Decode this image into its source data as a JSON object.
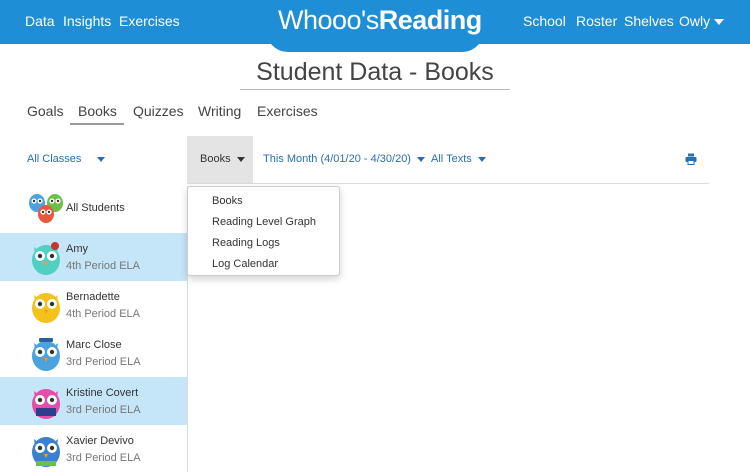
{
  "nav": {
    "left": [
      "Data",
      "Insights",
      "Exercises"
    ],
    "right": [
      "School",
      "Roster",
      "Shelves"
    ],
    "user": "Owly"
  },
  "logo": {
    "part1": "Whooo's",
    "part2": "Reading"
  },
  "page_title": "Student Data - Books",
  "tabs": [
    "Goals",
    "Books",
    "Quizzes",
    "Writing",
    "Exercises"
  ],
  "active_tab": "Books",
  "filters": {
    "classes": "All Classes",
    "view": "Books",
    "period": "This Month (4/01/20 - 4/30/20)",
    "texts": "All Texts"
  },
  "view_menu": [
    "Books",
    "Reading Level Graph",
    "Reading Logs",
    "Log Calendar"
  ],
  "all_students_label": "All Students",
  "students": [
    {
      "name": "Amy",
      "class": "4th Period ELA",
      "selected": true,
      "owl_color": "#4fd0c0"
    },
    {
      "name": "Bernadette",
      "class": "4th Period ELA",
      "selected": false,
      "owl_color": "#f5c21b"
    },
    {
      "name": "Marc Close",
      "class": "3rd Period ELA",
      "selected": false,
      "owl_color": "#4aa3df"
    },
    {
      "name": "Kristine Covert",
      "class": "3rd Period ELA",
      "selected": true,
      "owl_color": "#e64ca8"
    },
    {
      "name": "Xavier Devivo",
      "class": "3rd Period ELA",
      "selected": false,
      "owl_color": "#3b7fd1"
    }
  ],
  "colors": {
    "brand_blue": "#1e8ed6",
    "selected_row": "#c5e6f8",
    "link_blue": "#2a6fb0"
  }
}
